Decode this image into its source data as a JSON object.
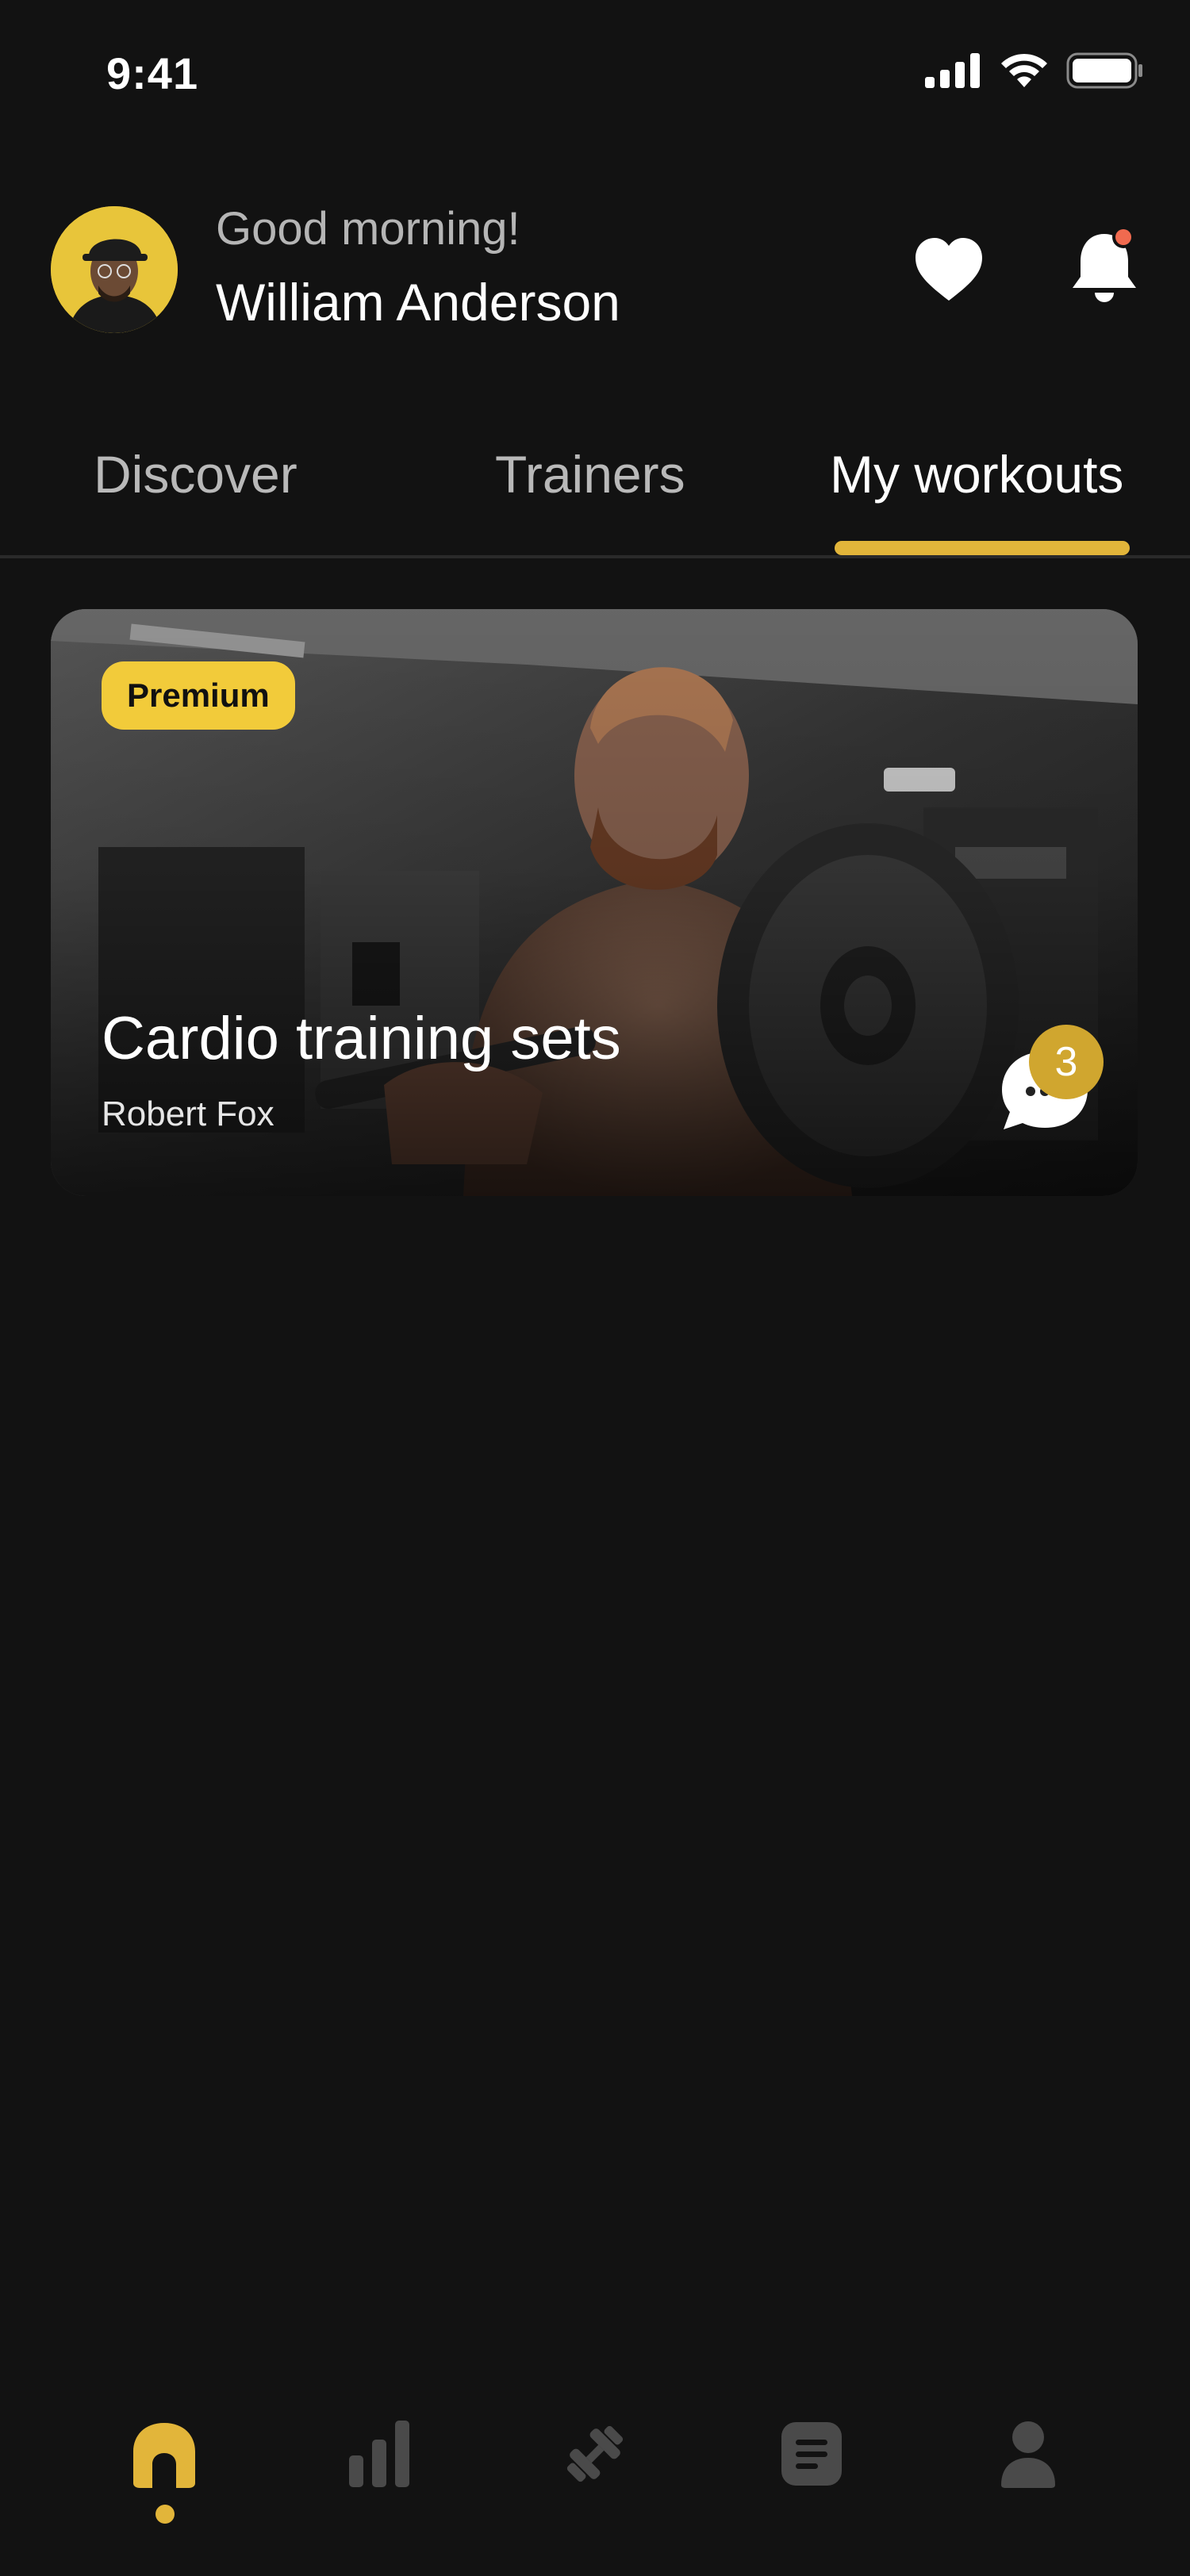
{
  "status_bar": {
    "time": "9:41",
    "icons": [
      "cellular-signal-icon",
      "wifi-icon",
      "battery-icon"
    ]
  },
  "header": {
    "greeting": "Good morning!",
    "user_name": "William Anderson",
    "actions": [
      "heart-icon",
      "bell-icon"
    ],
    "notification_dot_color": "#f06a4f"
  },
  "tabs": [
    {
      "label": "Discover",
      "active": false
    },
    {
      "label": "Trainers",
      "active": false
    },
    {
      "label": "My workouts",
      "active": true
    }
  ],
  "workout_card": {
    "badge": "Premium",
    "title": "Cardio training sets",
    "trainer": "Robert Fox",
    "message_count": "3"
  },
  "bottom_nav": {
    "items": [
      {
        "icon": "home-icon",
        "active": true
      },
      {
        "icon": "stats-icon",
        "active": false
      },
      {
        "icon": "dumbbell-icon",
        "active": false
      },
      {
        "icon": "document-icon",
        "active": false
      },
      {
        "icon": "profile-icon",
        "active": false
      }
    ]
  },
  "colors": {
    "background": "#121212",
    "accent": "#e2b53a",
    "badge": "#f2cb3a",
    "inactive_icon": "#4a4a4a"
  }
}
